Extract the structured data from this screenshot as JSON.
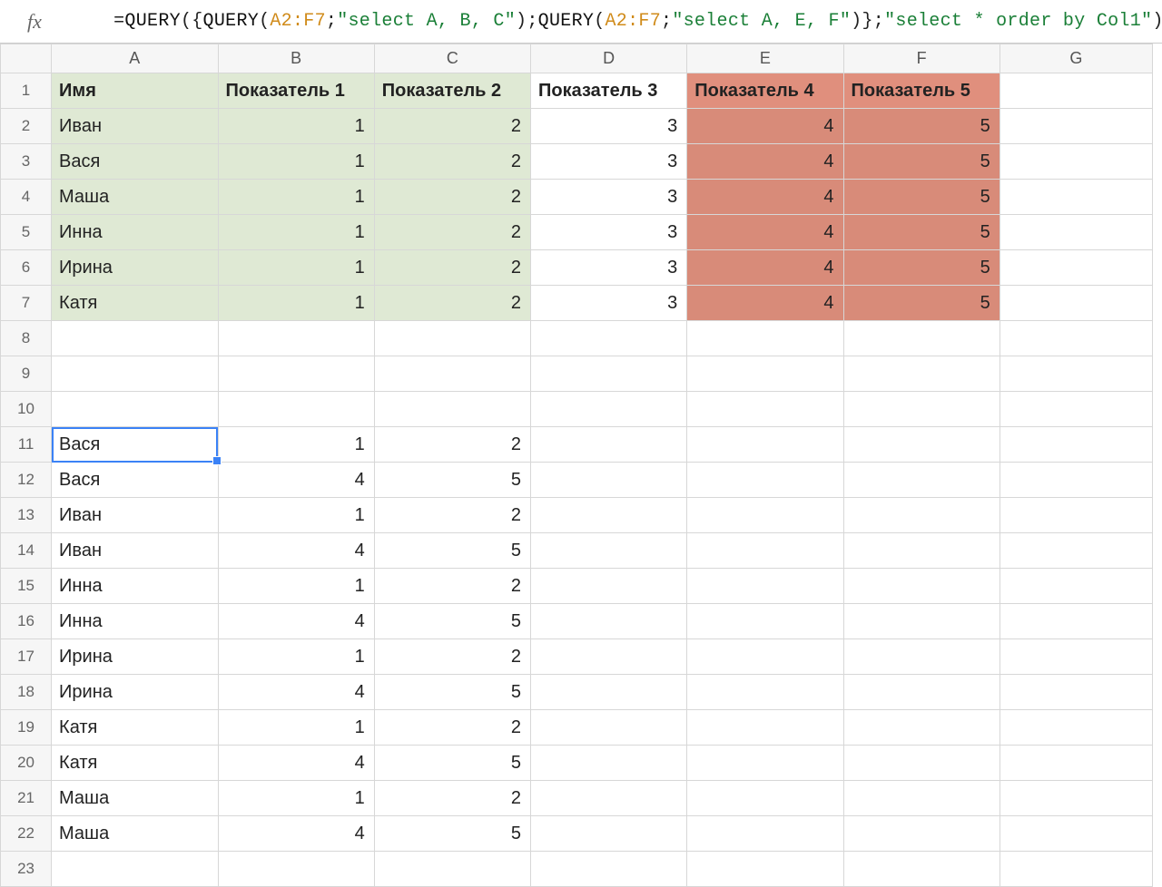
{
  "formula": {
    "prefix": "=",
    "fn_query": "QUERY",
    "open1": "({",
    "fn_query2": "QUERY",
    "open2": "(",
    "range": "A2:F7",
    "sep": ";",
    "str1": "\"select A, B, C\"",
    "close2": ")",
    "sep2": ";",
    "fn_query3": "QUERY",
    "open3": "(",
    "range2": "A2:F7",
    "sep3": ";",
    "str2": "\"select A, E, F\"",
    "close3": ")}",
    "sep4": ";",
    "str3": "\"select * order by Col1\"",
    "close1": ")"
  },
  "columns": [
    "A",
    "B",
    "C",
    "D",
    "E",
    "F",
    "G"
  ],
  "headers": {
    "A": "Имя",
    "B": "Показатель 1",
    "C": "Показатель 2",
    "D": "Показатель 3",
    "E": "Показатель 4",
    "F": "Показатель 5"
  },
  "topRows": [
    {
      "A": "Иван",
      "B": 1,
      "C": 2,
      "D": 3,
      "E": 4,
      "F": 5
    },
    {
      "A": "Вася",
      "B": 1,
      "C": 2,
      "D": 3,
      "E": 4,
      "F": 5
    },
    {
      "A": "Маша",
      "B": 1,
      "C": 2,
      "D": 3,
      "E": 4,
      "F": 5
    },
    {
      "A": "Инна",
      "B": 1,
      "C": 2,
      "D": 3,
      "E": 4,
      "F": 5
    },
    {
      "A": "Ирина",
      "B": 1,
      "C": 2,
      "D": 3,
      "E": 4,
      "F": 5
    },
    {
      "A": "Катя",
      "B": 1,
      "C": 2,
      "D": 3,
      "E": 4,
      "F": 5
    }
  ],
  "bottomRows": [
    {
      "A": "Вася",
      "B": 1,
      "C": 2
    },
    {
      "A": "Вася",
      "B": 4,
      "C": 5
    },
    {
      "A": "Иван",
      "B": 1,
      "C": 2
    },
    {
      "A": "Иван",
      "B": 4,
      "C": 5
    },
    {
      "A": "Инна",
      "B": 1,
      "C": 2
    },
    {
      "A": "Инна",
      "B": 4,
      "C": 5
    },
    {
      "A": "Ирина",
      "B": 1,
      "C": 2
    },
    {
      "A": "Ирина",
      "B": 4,
      "C": 5
    },
    {
      "A": "Катя",
      "B": 1,
      "C": 2
    },
    {
      "A": "Катя",
      "B": 4,
      "C": 5
    },
    {
      "A": "Маша",
      "B": 1,
      "C": 2
    },
    {
      "A": "Маша",
      "B": 4,
      "C": 5
    }
  ],
  "selectedCell": "A11",
  "rowNumbers": [
    1,
    2,
    3,
    4,
    5,
    6,
    7,
    8,
    9,
    10,
    11,
    12,
    13,
    14,
    15,
    16,
    17,
    18,
    19,
    20,
    21,
    22,
    23
  ]
}
